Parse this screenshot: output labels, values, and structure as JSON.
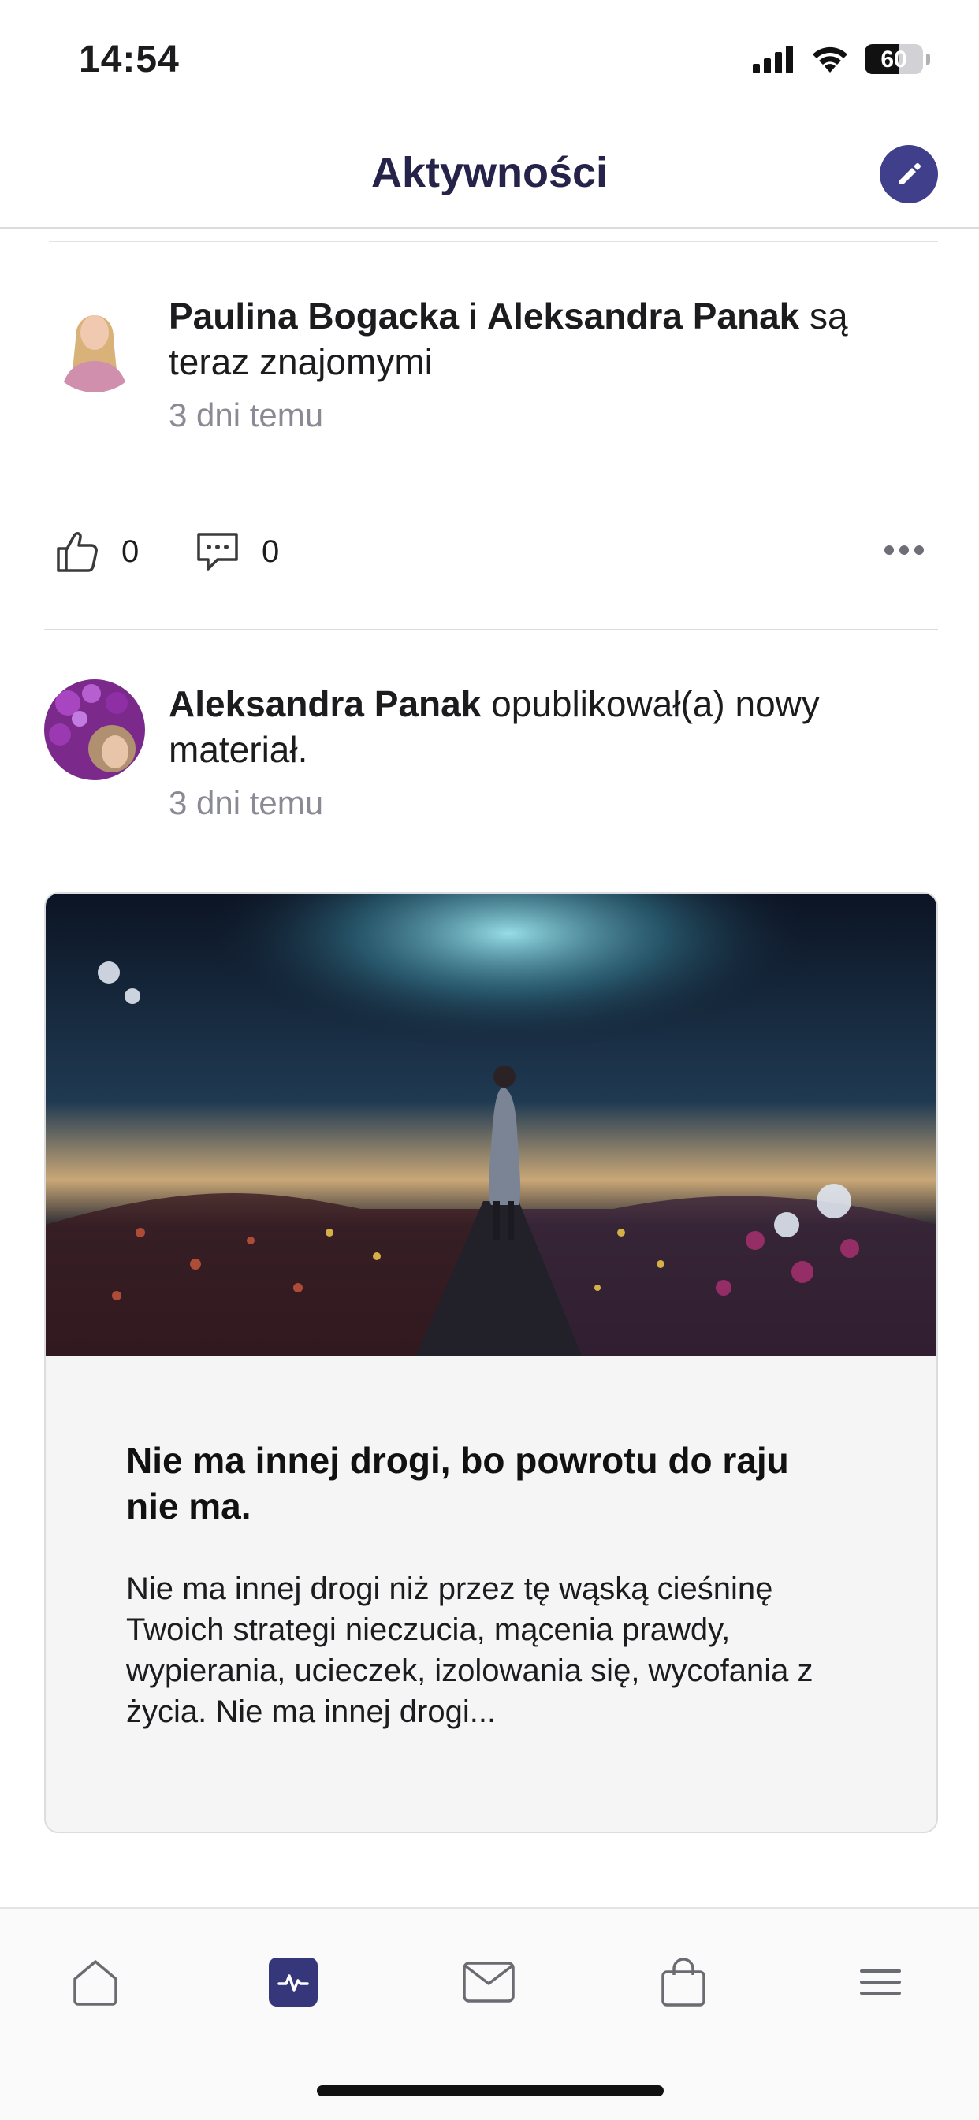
{
  "status_bar": {
    "time": "14:54",
    "battery": "60",
    "battery_level": 0.6
  },
  "header": {
    "title": "Aktywności"
  },
  "activities": [
    {
      "user1": "Paulina Bogacka",
      "connector": " i ",
      "user2": "Aleksandra Panak",
      "action": " są teraz znajomymi",
      "time_ago": "3 dni temu",
      "likes": "0",
      "comments": "0"
    },
    {
      "user": "Aleksandra Panak",
      "action": " opublikował(a) nowy materiał.",
      "time_ago": "3 dni temu",
      "card": {
        "title": "Nie ma innej drogi, bo powrotu do raju nie ma.",
        "excerpt": "Nie ma innej drogi niż przez tę wąską cieśninę Twoich strategi nieczucia, mącenia prawdy, wypierania, ucieczek, izolowania się, wycofania z życia. Nie ma innej drogi..."
      }
    }
  ],
  "tabs": [
    {
      "icon": "home-icon",
      "active": false
    },
    {
      "icon": "activity-icon",
      "active": true
    },
    {
      "icon": "mail-icon",
      "active": false
    },
    {
      "icon": "shopping-bag-icon",
      "active": false
    },
    {
      "icon": "menu-icon",
      "active": false
    }
  ],
  "colors": {
    "accent": "#3f3f8c",
    "title": "#25234a",
    "muted": "#8a8a94"
  }
}
